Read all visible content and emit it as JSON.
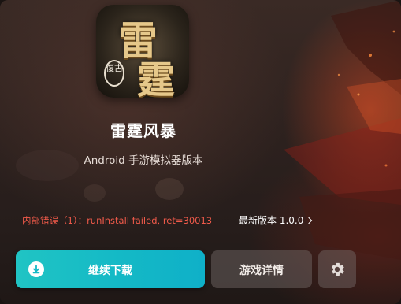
{
  "app": {
    "icon_name": "game-app-icon",
    "icon_text_main_1": "雷",
    "icon_text_main_2": "霆",
    "icon_text_seal": "復古",
    "title": "雷霆风暴",
    "subtitle": "Android 手游模拟器版本"
  },
  "status": {
    "error_message": "内部错误（1）：runInstall failed, ret=30013",
    "error_color": "#f05a4a"
  },
  "version": {
    "label": "最新版本 1.0.0"
  },
  "actions": {
    "primary_label": "继续下载",
    "primary_icon": "download-icon",
    "primary_color": "#14b9c6",
    "secondary_label": "游戏详情",
    "settings_icon": "gear-icon"
  }
}
